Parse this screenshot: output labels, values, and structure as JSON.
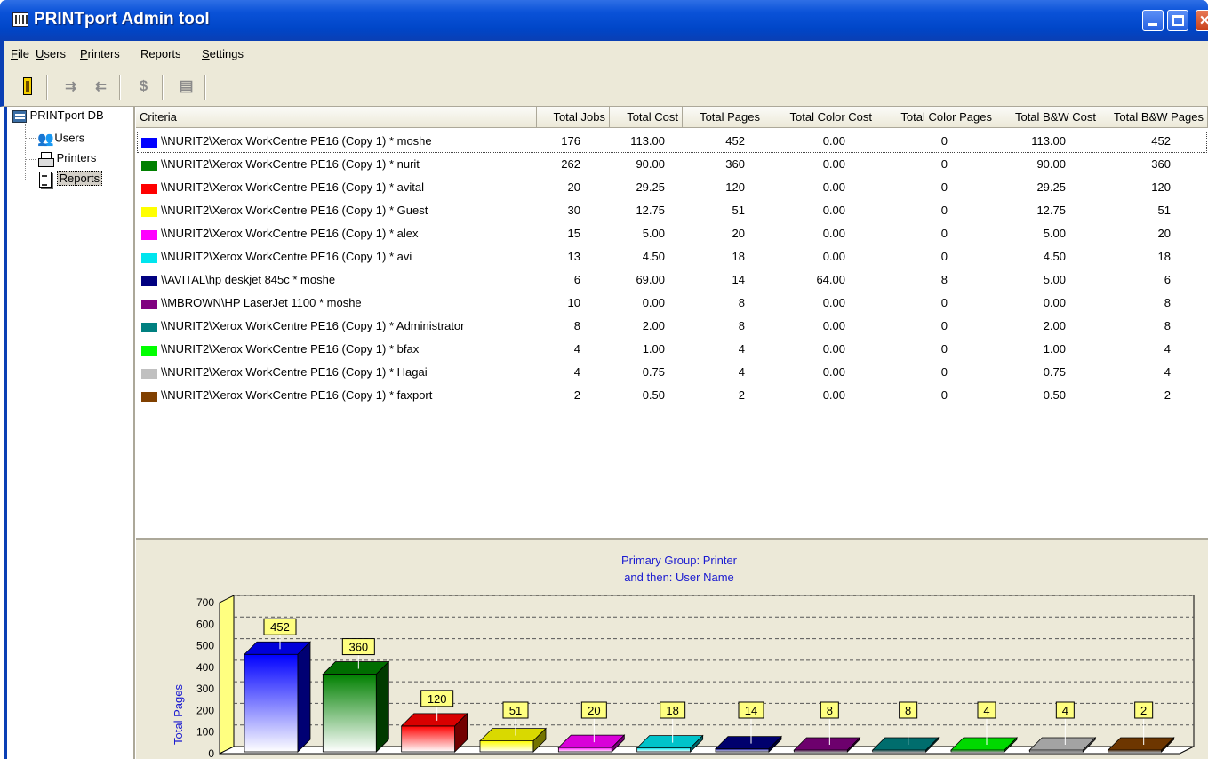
{
  "window": {
    "title": "PRINTport Admin tool"
  },
  "menu": [
    {
      "label": "File",
      "accel": "F",
      "rest": "ile"
    },
    {
      "label": "Users",
      "accel": "U",
      "rest": "sers"
    },
    {
      "label": "Printers",
      "accel": "P",
      "rest": "rinters"
    },
    {
      "label": "Reports",
      "accel": "",
      "rest": "Reports"
    },
    {
      "label": "Settings",
      "accel": "S",
      "rest": "ettings"
    }
  ],
  "toolbar": {
    "buttons": [
      "exit-icon",
      "add-rows-icon",
      "remove-rows-icon",
      "dollar-icon",
      "report-icon"
    ]
  },
  "tree": {
    "root": "PRINTport DB",
    "children": [
      "Users",
      "Printers",
      "Reports"
    ],
    "selected": "Reports"
  },
  "table": {
    "columns": [
      "Criteria",
      "Total Jobs",
      "Total Cost",
      "Total Pages",
      "Total Color Cost",
      "Total Color Pages",
      "Total B&W Cost",
      "Total B&W Pages"
    ],
    "rows": [
      {
        "color": "#0000ff",
        "criteria": "\\\\NURIT2\\Xerox WorkCentre PE16 (Copy 1) * moshe",
        "jobs": "176",
        "cost": "113.00",
        "pages": "452",
        "color_cost": "0.00",
        "color_pages": "0",
        "bw_cost": "113.00",
        "bw_pages": "452"
      },
      {
        "color": "#008000",
        "criteria": "\\\\NURIT2\\Xerox WorkCentre PE16 (Copy 1) * nurit",
        "jobs": "262",
        "cost": "90.00",
        "pages": "360",
        "color_cost": "0.00",
        "color_pages": "0",
        "bw_cost": "90.00",
        "bw_pages": "360"
      },
      {
        "color": "#ff0000",
        "criteria": "\\\\NURIT2\\Xerox WorkCentre PE16 (Copy 1) * avital",
        "jobs": "20",
        "cost": "29.25",
        "pages": "120",
        "color_cost": "0.00",
        "color_pages": "0",
        "bw_cost": "29.25",
        "bw_pages": "120"
      },
      {
        "color": "#ffff00",
        "criteria": "\\\\NURIT2\\Xerox WorkCentre PE16 (Copy 1) * Guest",
        "jobs": "30",
        "cost": "12.75",
        "pages": "51",
        "color_cost": "0.00",
        "color_pages": "0",
        "bw_cost": "12.75",
        "bw_pages": "51"
      },
      {
        "color": "#ff00ff",
        "criteria": "\\\\NURIT2\\Xerox WorkCentre PE16 (Copy 1) * alex",
        "jobs": "15",
        "cost": "5.00",
        "pages": "20",
        "color_cost": "0.00",
        "color_pages": "0",
        "bw_cost": "5.00",
        "bw_pages": "20"
      },
      {
        "color": "#00e5ee",
        "criteria": "\\\\NURIT2\\Xerox WorkCentre PE16 (Copy 1) * avi",
        "jobs": "13",
        "cost": "4.50",
        "pages": "18",
        "color_cost": "0.00",
        "color_pages": "0",
        "bw_cost": "4.50",
        "bw_pages": "18"
      },
      {
        "color": "#000080",
        "criteria": "\\\\AVITAL\\hp deskjet 845c * moshe",
        "jobs": "6",
        "cost": "69.00",
        "pages": "14",
        "color_cost": "64.00",
        "color_pages": "8",
        "bw_cost": "5.00",
        "bw_pages": "6"
      },
      {
        "color": "#800080",
        "criteria": "\\\\MBROWN\\HP LaserJet 1100 * moshe",
        "jobs": "10",
        "cost": "0.00",
        "pages": "8",
        "color_cost": "0.00",
        "color_pages": "0",
        "bw_cost": "0.00",
        "bw_pages": "8"
      },
      {
        "color": "#008080",
        "criteria": "\\\\NURIT2\\Xerox WorkCentre PE16 (Copy 1) * Administrator",
        "jobs": "8",
        "cost": "2.00",
        "pages": "8",
        "color_cost": "0.00",
        "color_pages": "0",
        "bw_cost": "2.00",
        "bw_pages": "8"
      },
      {
        "color": "#00ff00",
        "criteria": "\\\\NURIT2\\Xerox WorkCentre PE16 (Copy 1) * bfax",
        "jobs": "4",
        "cost": "1.00",
        "pages": "4",
        "color_cost": "0.00",
        "color_pages": "0",
        "bw_cost": "1.00",
        "bw_pages": "4"
      },
      {
        "color": "#c0c0c0",
        "criteria": "\\\\NURIT2\\Xerox WorkCentre PE16 (Copy 1) * Hagai",
        "jobs": "4",
        "cost": "0.75",
        "pages": "4",
        "color_cost": "0.00",
        "color_pages": "0",
        "bw_cost": "0.75",
        "bw_pages": "4"
      },
      {
        "color": "#804000",
        "criteria": "\\\\NURIT2\\Xerox WorkCentre PE16 (Copy 1) * faxport",
        "jobs": "2",
        "cost": "0.50",
        "pages": "2",
        "color_cost": "0.00",
        "color_pages": "0",
        "bw_cost": "0.50",
        "bw_pages": "2"
      }
    ]
  },
  "chart_data": {
    "type": "bar",
    "title": "Primary Group: Printer",
    "subtitle": "and then: User Name",
    "ylabel": "Total Pages",
    "xlabel": "",
    "ylim": [
      0,
      700
    ],
    "yticks": [
      0,
      100,
      200,
      300,
      400,
      500,
      600,
      700
    ],
    "grid": true,
    "categories": [
      "\\\\NURIT2\\Xerox WorkCentre PE16 (Copy 1) * moshe",
      "\\\\NURIT2\\Xerox WorkCentre PE16 (Copy 1) * nurit",
      "\\\\NURIT2\\Xerox WorkCentre PE16 (Copy 1) * avital",
      "\\\\NURIT2\\Xerox WorkCentre PE16 (Copy 1) * Guest",
      "\\\\NURIT2\\Xerox WorkCentre PE16 (Copy 1) * alex",
      "\\\\NURIT2\\Xerox WorkCentre PE16 (Copy 1) * avi",
      "\\\\AVITAL\\hp deskjet 845c * moshe",
      "\\\\MBROWN\\HP LaserJet 1100 * moshe",
      "\\\\NURIT2\\Xerox WorkCentre PE16 (Copy 1) * Administrator",
      "\\\\NURIT2\\Xerox WorkCentre PE16 (Copy 1) * bfax",
      "\\\\NURIT2\\Xerox WorkCentre PE16 (Copy 1) * Hagai",
      "\\\\NURIT2\\Xerox WorkCentre PE16 (Copy 1) * faxport"
    ],
    "values": [
      452,
      360,
      120,
      51,
      20,
      18,
      14,
      8,
      8,
      4,
      4,
      2
    ],
    "colors": [
      "#0000ff",
      "#008000",
      "#ff0000",
      "#ffff00",
      "#ff00ff",
      "#00e5ee",
      "#000080",
      "#800080",
      "#008080",
      "#00ff00",
      "#c0c0c0",
      "#804000"
    ],
    "data_labels": [
      "452",
      "360",
      "120",
      "51",
      "20",
      "18",
      "14",
      "8",
      "8",
      "4",
      "4",
      "2"
    ]
  }
}
